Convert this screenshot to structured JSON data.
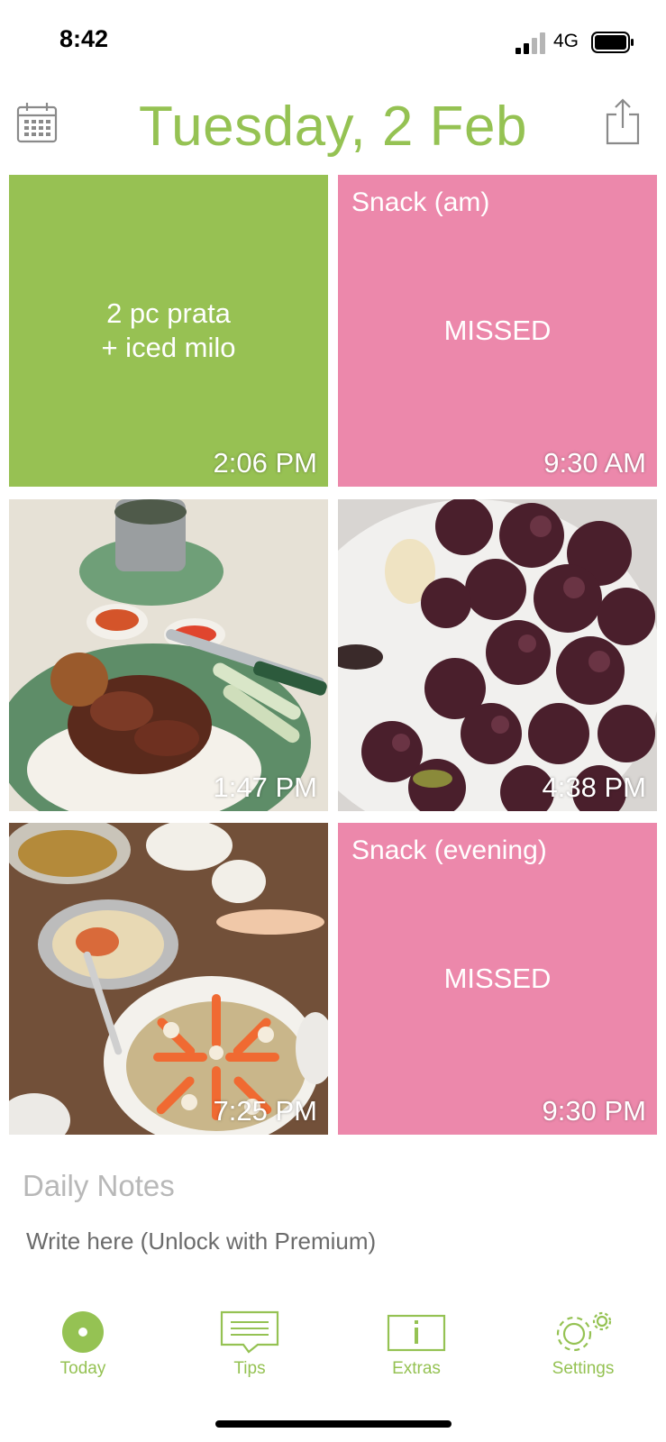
{
  "status": {
    "time": "8:42",
    "network": "4G"
  },
  "header": {
    "title": "Tuesday, 2 Feb"
  },
  "tiles": [
    {
      "kind": "note",
      "color": "#97c153",
      "label": "",
      "text": "2 pc prata\n+ iced milo",
      "time": "2:06 PM"
    },
    {
      "kind": "missed",
      "color": "#ec88ab",
      "label": "Snack (am)",
      "text": "MISSED",
      "time": "9:30 AM"
    },
    {
      "kind": "photo",
      "photo": "char-siu-rice-plate",
      "time": "1:47 PM"
    },
    {
      "kind": "photo",
      "photo": "red-grapes-plate",
      "time": "4:38 PM"
    },
    {
      "kind": "photo",
      "photo": "seafood-noodle-dinner",
      "time": "7:25 PM"
    },
    {
      "kind": "missed",
      "color": "#ec88ab",
      "label": "Snack (evening)",
      "text": "MISSED",
      "time": "9:30 PM"
    }
  ],
  "notes": {
    "title": "Daily Notes",
    "placeholder": "Write here (Unlock with Premium)"
  },
  "tabs": [
    {
      "label": "Today",
      "icon": "today-dot-icon"
    },
    {
      "label": "Tips",
      "icon": "speech-bubble-icon"
    },
    {
      "label": "Extras",
      "icon": "info-box-icon"
    },
    {
      "label": "Settings",
      "icon": "gears-icon"
    }
  ],
  "colors": {
    "accent": "#95c253",
    "missed": "#ec88ab",
    "meal": "#97c153"
  }
}
